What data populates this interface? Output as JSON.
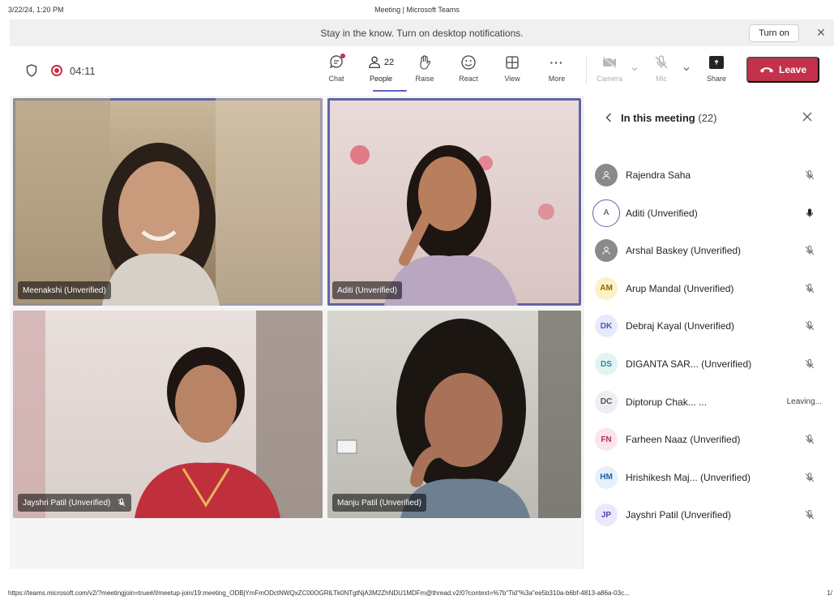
{
  "print_header": {
    "date": "3/22/24, 1:20 PM",
    "title": "Meeting | Microsoft Teams"
  },
  "notification": {
    "message": "Stay in the know. Turn on desktop notifications.",
    "button": "Turn on",
    "close": "✕"
  },
  "toolbar": {
    "timer": "04:11",
    "chat_label": "Chat",
    "people_label": "People",
    "people_count": "22",
    "raise_label": "Raise",
    "react_label": "React",
    "view_label": "View",
    "more_label": "More",
    "more_glyph": "···",
    "camera_label": "Camera",
    "mic_label": "Mic",
    "share_label": "Share",
    "leave_label": "Leave"
  },
  "tiles": [
    {
      "name": "Meenakshi (Unverified)",
      "speaking": true
    },
    {
      "name": "Aditi (Unverified)",
      "speaking": true
    },
    {
      "name": "Jayshri Patil (Unverified)",
      "muted": true
    },
    {
      "name": "Manju Patil (Unverified)"
    }
  ],
  "panel": {
    "title": "In this meeting",
    "count": "(22)",
    "participants": [
      {
        "initials": "",
        "name": "Rajendra Saha",
        "status": "mic-off",
        "avatar_bg": "#8a8a8a",
        "avatar_fg": "#ffffff"
      },
      {
        "initials": "A",
        "name": "Aditi (Unverified)",
        "status": "mic-on",
        "avatar_bg": "#ffffff",
        "avatar_fg": "#424242"
      },
      {
        "initials": "",
        "name": "Arshal Baskey (Unverified)",
        "status": "mic-off",
        "avatar_bg": "#8a8a8a",
        "avatar_fg": "#ffffff"
      },
      {
        "initials": "AM",
        "name": "Arup Mandal (Unverified)",
        "status": "mic-off",
        "avatar_bg": "#fdf1c8",
        "avatar_fg": "#8a6d00"
      },
      {
        "initials": "DK",
        "name": "Debraj Kayal (Unverified)",
        "status": "mic-off",
        "avatar_bg": "#e8eafc",
        "avatar_fg": "#4f52b2"
      },
      {
        "initials": "DS",
        "name": "DIGANTA SAR...  (Unverified)",
        "status": "mic-off",
        "avatar_bg": "#e2f3f4",
        "avatar_fg": "#2f8a93"
      },
      {
        "initials": "DC",
        "name": "Diptorup Chak...  ...",
        "status": "text",
        "status_text": "Leaving...",
        "avatar_bg": "#eceef1",
        "avatar_fg": "#4a5568"
      },
      {
        "initials": "FN",
        "name": "Farheen Naaz (Unverified)",
        "status": "mic-off",
        "avatar_bg": "#fce4ec",
        "avatar_fg": "#b03060"
      },
      {
        "initials": "HM",
        "name": "Hrishikesh Maj...  (Unverified)",
        "status": "mic-off",
        "avatar_bg": "#e5f0fa",
        "avatar_fg": "#1d5fa8"
      },
      {
        "initials": "JP",
        "name": "Jayshri Patil (Unverified)",
        "status": "mic-off",
        "avatar_bg": "#ece7fb",
        "avatar_fg": "#5a3fb0"
      }
    ]
  },
  "footer": {
    "url": "https://teams.microsoft.com/v2/?meetingjoin=true#/l/meetup-join/19:meeting_ODBjYmFmODctNWQxZC00OGRlLTk0NTgtNjA3M2ZhNDU1MDFm@thread.v2/0?context=%7b\"Tid\"%3a\"ee5b310a-b6bf-4813-a86a-03c...",
    "page": "1/"
  },
  "colors": {
    "accent": "#5b5fc7",
    "leave": "#c4314b",
    "speaking_outline": "#6264a7"
  }
}
